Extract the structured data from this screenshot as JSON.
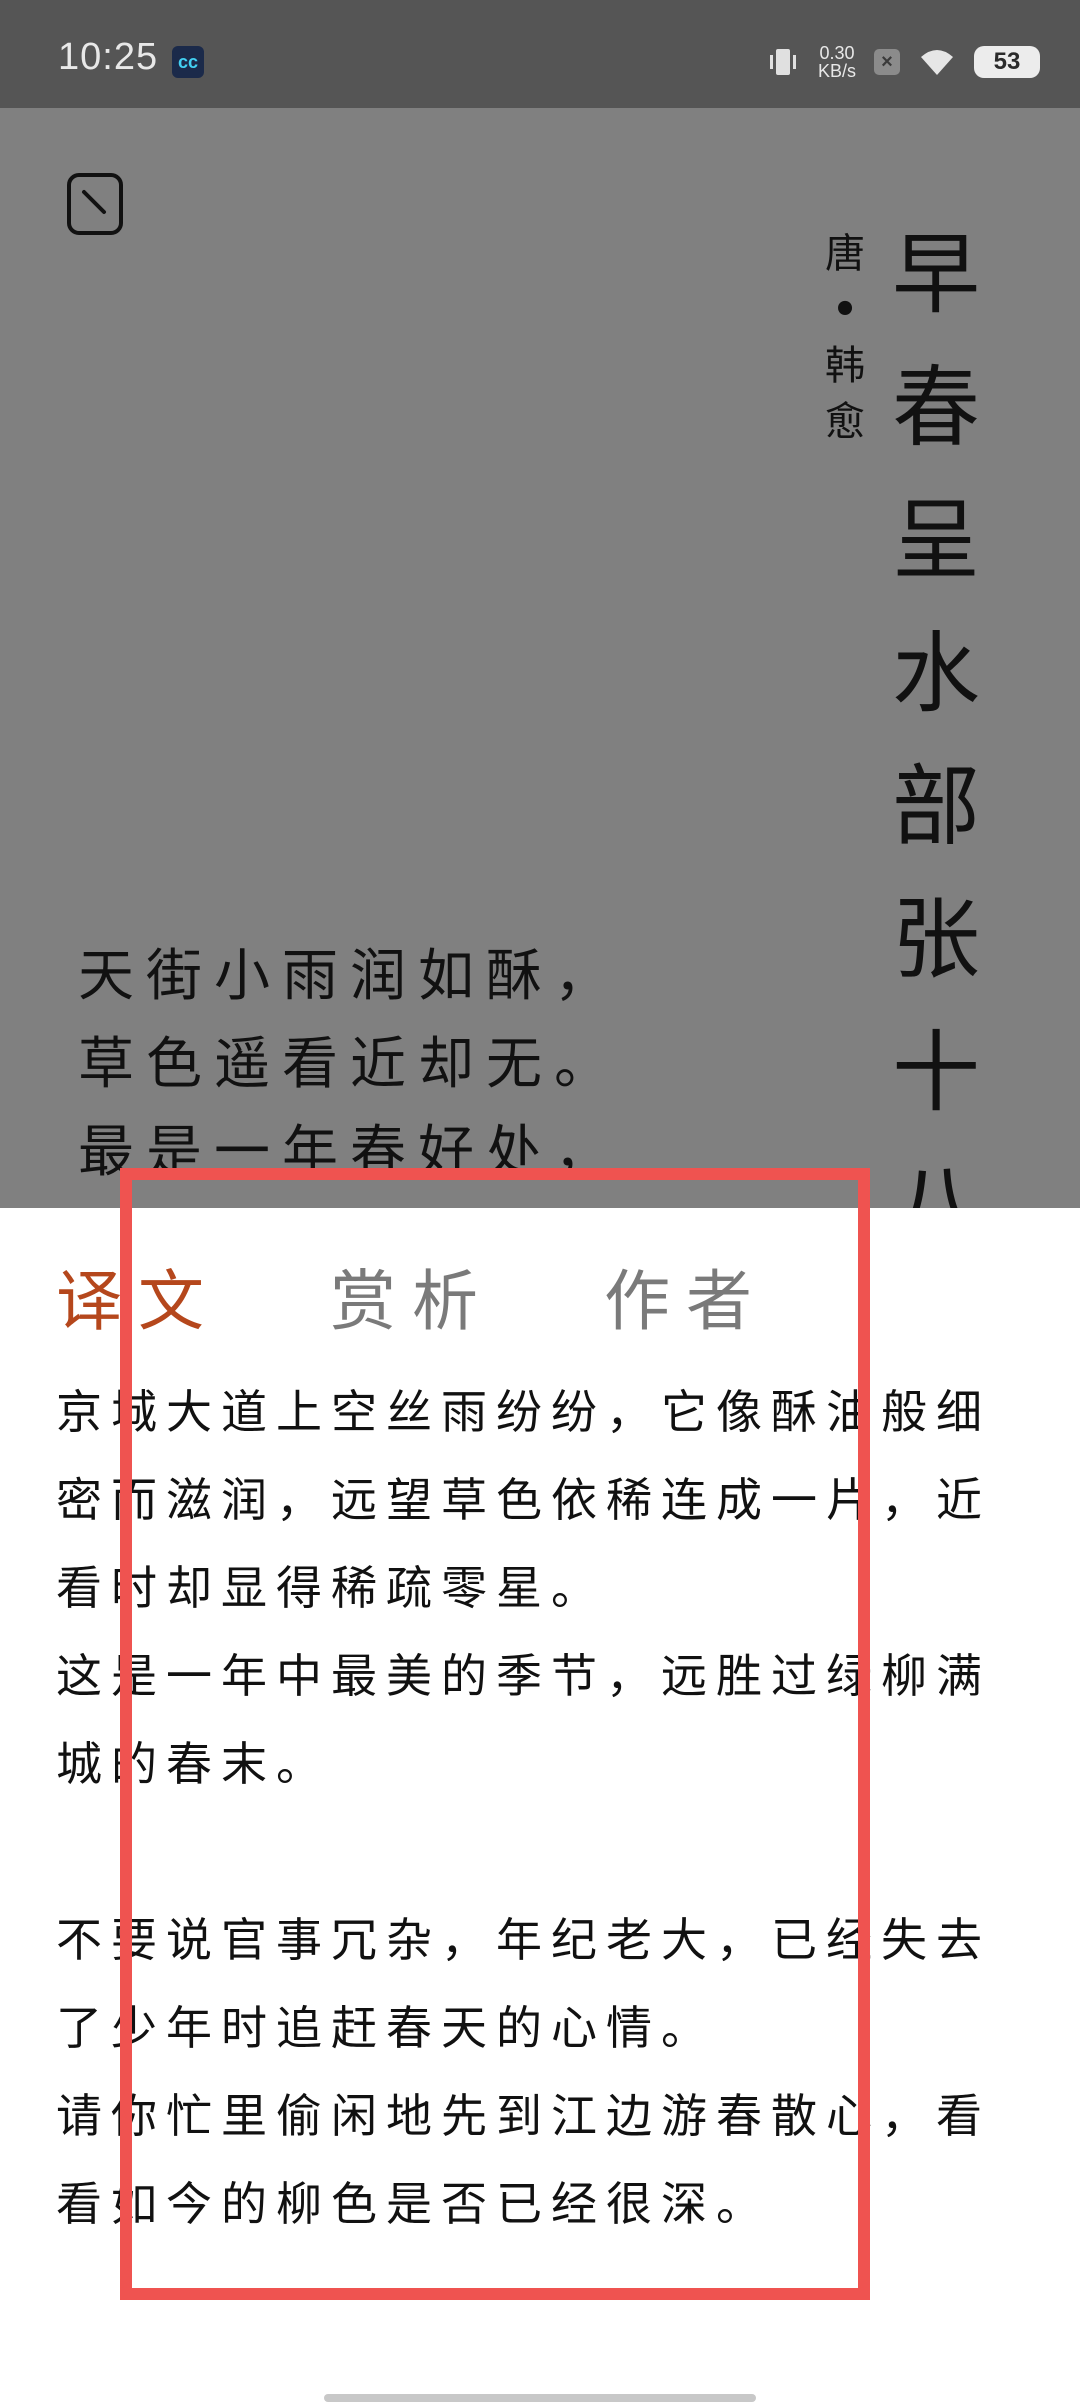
{
  "status_bar": {
    "time": "10:25",
    "app_icon_text": "cc",
    "net_speed_value": "0.30",
    "net_speed_unit": "KB/s",
    "battery": "53"
  },
  "poem": {
    "title_chars": "早春呈水部张十八",
    "dynasty": "唐",
    "dot": "•",
    "author": "韩愈",
    "lines": [
      "天街小雨润如酥，",
      "草色遥看近却无。",
      "最是一年春好处，"
    ]
  },
  "tabs": [
    {
      "label": "译文",
      "active": true
    },
    {
      "label": "赏析",
      "active": false
    },
    {
      "label": "作者",
      "active": false
    }
  ],
  "translation": {
    "paragraph1_a": "京城大道上空丝雨纷纷，它像酥油般细密而滋润，远望草色依稀连成一片，近看时却显得稀疏零星。",
    "paragraph1_b": "这是一年中最美的季节，远胜过绿柳满城的春末。",
    "paragraph2_a": "不要说官事冗杂，年纪老大，已经失去了少年时追赶春天的心情。",
    "paragraph2_b": "请你忙里偷闲地先到江边游春散心，看看如今的柳色是否已经很深。"
  },
  "colors": {
    "active_tab": "#b5471c",
    "inactive_tab": "#7a7a7a",
    "highlight_box": "#ef5350",
    "dim_overlay": "#808080"
  }
}
